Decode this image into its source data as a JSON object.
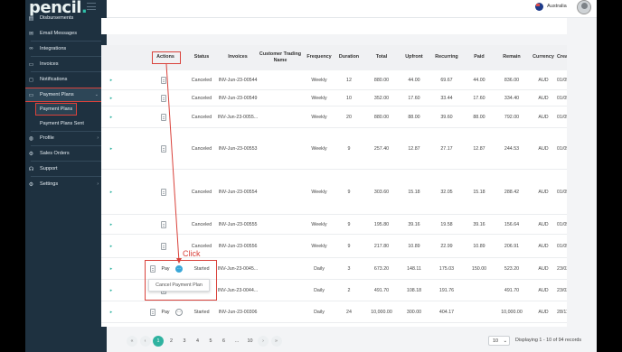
{
  "brand": {
    "name": "pencil",
    "dot": "."
  },
  "sidebar": {
    "items": [
      {
        "label": "Disbursements",
        "icon": "wallet-icon",
        "glyph": "▤"
      },
      {
        "label": "Email Messages",
        "icon": "envelope-icon",
        "glyph": "✉"
      },
      {
        "label": "Integrations",
        "icon": "link-icon",
        "glyph": "∞"
      },
      {
        "label": "Invoices",
        "icon": "invoice-icon",
        "glyph": "▭"
      },
      {
        "label": "Notifications",
        "icon": "bell-icon",
        "glyph": "◻"
      },
      {
        "label": "Payment Plans",
        "icon": "plans-icon",
        "glyph": "▭",
        "chevron": "⌄"
      },
      {
        "label": "Profile",
        "icon": "globe-icon",
        "glyph": "◍",
        "chevron": "›"
      },
      {
        "label": "Sales Orders",
        "icon": "cart-icon",
        "glyph": "⚙"
      },
      {
        "label": "Support",
        "icon": "headset-icon",
        "glyph": "☊"
      },
      {
        "label": "Settings",
        "icon": "gear-icon",
        "glyph": "⚙",
        "chevron": "›"
      }
    ],
    "sub_items": [
      {
        "label": "Payment Plans"
      },
      {
        "label": "Payment Plans Sent"
      }
    ]
  },
  "topbar": {
    "country": "Australia"
  },
  "table": {
    "headers": [
      "",
      "",
      "Actions",
      "Status",
      "Invoices",
      "Customer Trading Name",
      "Frequency",
      "Duration",
      "Total",
      "Upfront",
      "Recurring",
      "Paid",
      "Remain",
      "Currency",
      "Created At"
    ],
    "rows": [
      {
        "status": "Canceled",
        "invoice": "INV-Jun-23-00544",
        "frequency": "Weekly",
        "duration": "12",
        "total": "880.00",
        "upfront": "44.00",
        "recurring": "69.67",
        "paid": "44.00",
        "remain": "836.00",
        "currency": "AUD",
        "created": "01/05/202"
      },
      {
        "status": "Canceled",
        "invoice": "INV-Jun-23-00549",
        "frequency": "Weekly",
        "duration": "10",
        "total": "352.00",
        "upfront": "17.60",
        "recurring": "33.44",
        "paid": "17.60",
        "remain": "334.40",
        "currency": "AUD",
        "created": "01/05/202"
      },
      {
        "status": "Canceled",
        "invoice": "INV-Jun-23-0055...",
        "frequency": "Weekly",
        "duration": "20",
        "total": "880.00",
        "upfront": "88.00",
        "recurring": "39.60",
        "paid": "88.00",
        "remain": "792.00",
        "currency": "AUD",
        "created": "01/05/202"
      },
      {
        "status": "Canceled",
        "invoice": "INV-Jun-23-00553",
        "frequency": "Weekly",
        "duration": "9",
        "total": "257.40",
        "upfront": "12.87",
        "recurring": "27.17",
        "paid": "12.87",
        "remain": "244.53",
        "currency": "AUD",
        "created": "01/05/202"
      },
      {
        "status": "Canceled",
        "invoice": "INV-Jun-23-00554",
        "frequency": "Weekly",
        "duration": "9",
        "total": "303.60",
        "upfront": "15.18",
        "recurring": "32.05",
        "paid": "15.18",
        "remain": "288.42",
        "currency": "AUD",
        "created": "01/05/202"
      },
      {
        "status": "Canceled",
        "invoice": "INV-Jun-23-00555",
        "frequency": "Weekly",
        "duration": "9",
        "total": "195.80",
        "upfront": "39.16",
        "recurring": "19.58",
        "paid": "39.16",
        "remain": "156.64",
        "currency": "AUD",
        "created": "01/05/202"
      },
      {
        "status": "Canceled",
        "invoice": "INV-Jun-23-00556",
        "frequency": "Weekly",
        "duration": "9",
        "total": "217.80",
        "upfront": "10.89",
        "recurring": "22.99",
        "paid": "10.89",
        "remain": "206.91",
        "currency": "AUD",
        "created": "01/05/202"
      },
      {
        "pay": "Pay",
        "status": "Started",
        "invoice": "INV-Jun-23-0045...",
        "frequency": "Daily",
        "duration": "3",
        "total": "673.20",
        "upfront": "148.11",
        "recurring": "175.03",
        "paid": "150.00",
        "remain": "523.20",
        "currency": "AUD",
        "created": "23/02/202"
      },
      {
        "status": "",
        "invoice": "INV-Jun-23-0044...",
        "frequency": "Daily",
        "duration": "2",
        "total": "491.70",
        "upfront": "108.18",
        "recurring": "191.76",
        "paid": "",
        "remain": "491.70",
        "currency": "AUD",
        "created": "23/02/202"
      },
      {
        "pay": "Pay",
        "status": "Started",
        "invoice": "INV-Jun-23-00306",
        "frequency": "Daily",
        "duration": "24",
        "total": "10,000.00",
        "upfront": "300.00",
        "recurring": "404.17",
        "paid": "",
        "remain": "10,000.00",
        "currency": "AUD",
        "created": "28/11/202"
      }
    ]
  },
  "annotation": {
    "click_label": "Click",
    "color": "#d9423b"
  },
  "popup": {
    "label": "Cancel Payment Plan"
  },
  "pagination": {
    "pages": [
      "1",
      "2",
      "3",
      "4",
      "5",
      "6",
      "...",
      "10"
    ],
    "active": "1",
    "per_page": "10",
    "displaying": "Displaying 1 - 10 of 94 records"
  },
  "colors": {
    "sidebar": "#1e3140",
    "accent": "#2fb2a0",
    "highlight": "#3aa7d8"
  }
}
